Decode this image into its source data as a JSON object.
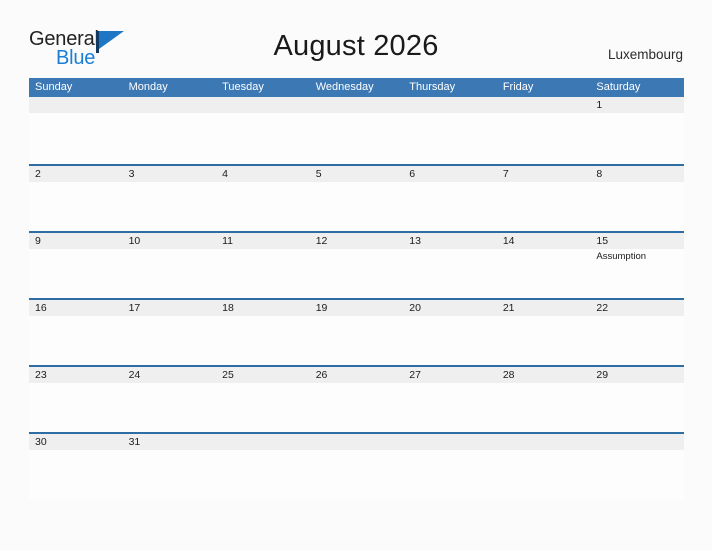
{
  "brand": {
    "name_part1": "General",
    "name_part2": "Blue",
    "flag_icon": "flag-icon",
    "color_dark": "#222222",
    "color_blue": "#1a7fd4"
  },
  "header": {
    "title": "August 2026",
    "location": "Luxembourg"
  },
  "colors": {
    "header_blue": "#3c78b4",
    "row_divider_blue": "#2e6da4",
    "number_band_gray": "#efefef",
    "page_background": "#fbfbfb"
  },
  "calendar": {
    "weekdays": [
      "Sunday",
      "Monday",
      "Tuesday",
      "Wednesday",
      "Thursday",
      "Friday",
      "Saturday"
    ],
    "weeks": [
      [
        {
          "day": "",
          "event": ""
        },
        {
          "day": "",
          "event": ""
        },
        {
          "day": "",
          "event": ""
        },
        {
          "day": "",
          "event": ""
        },
        {
          "day": "",
          "event": ""
        },
        {
          "day": "",
          "event": ""
        },
        {
          "day": "1",
          "event": ""
        }
      ],
      [
        {
          "day": "2",
          "event": ""
        },
        {
          "day": "3",
          "event": ""
        },
        {
          "day": "4",
          "event": ""
        },
        {
          "day": "5",
          "event": ""
        },
        {
          "day": "6",
          "event": ""
        },
        {
          "day": "7",
          "event": ""
        },
        {
          "day": "8",
          "event": ""
        }
      ],
      [
        {
          "day": "9",
          "event": ""
        },
        {
          "day": "10",
          "event": ""
        },
        {
          "day": "11",
          "event": ""
        },
        {
          "day": "12",
          "event": ""
        },
        {
          "day": "13",
          "event": ""
        },
        {
          "day": "14",
          "event": ""
        },
        {
          "day": "15",
          "event": "Assumption"
        }
      ],
      [
        {
          "day": "16",
          "event": ""
        },
        {
          "day": "17",
          "event": ""
        },
        {
          "day": "18",
          "event": ""
        },
        {
          "day": "19",
          "event": ""
        },
        {
          "day": "20",
          "event": ""
        },
        {
          "day": "21",
          "event": ""
        },
        {
          "day": "22",
          "event": ""
        }
      ],
      [
        {
          "day": "23",
          "event": ""
        },
        {
          "day": "24",
          "event": ""
        },
        {
          "day": "25",
          "event": ""
        },
        {
          "day": "26",
          "event": ""
        },
        {
          "day": "27",
          "event": ""
        },
        {
          "day": "28",
          "event": ""
        },
        {
          "day": "29",
          "event": ""
        }
      ],
      [
        {
          "day": "30",
          "event": ""
        },
        {
          "day": "31",
          "event": ""
        },
        {
          "day": "",
          "event": ""
        },
        {
          "day": "",
          "event": ""
        },
        {
          "day": "",
          "event": ""
        },
        {
          "day": "",
          "event": ""
        },
        {
          "day": "",
          "event": ""
        }
      ]
    ]
  }
}
